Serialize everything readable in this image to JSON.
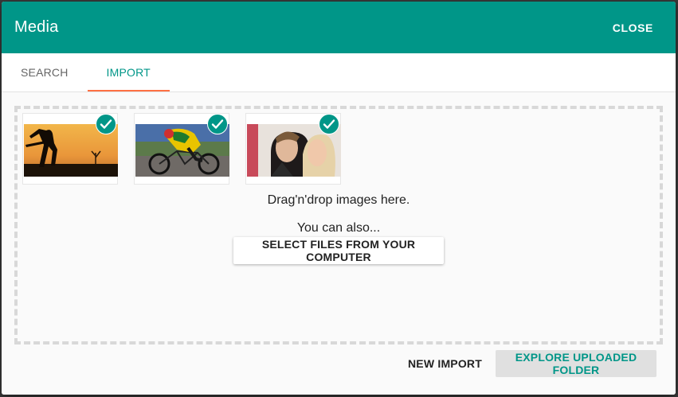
{
  "dialog": {
    "title": "Media",
    "close_label": "CLOSE"
  },
  "tabs": [
    {
      "label": "SEARCH",
      "active": false
    },
    {
      "label": "IMPORT",
      "active": true
    }
  ],
  "dropzone": {
    "thumbnails": [
      {
        "icon": "check-icon",
        "subject": "cricket-silhouette-sunset",
        "selected": true
      },
      {
        "icon": "check-icon",
        "subject": "cyclist-racing",
        "selected": true
      },
      {
        "icon": "check-icon",
        "subject": "couple-portrait",
        "selected": true
      }
    ],
    "drop_text": "Drag'n'drop images here.",
    "also_text": "You can also...",
    "select_button": "SELECT FILES FROM YOUR COMPUTER"
  },
  "footer": {
    "new_import": "NEW IMPORT",
    "explore": "EXPLORE UPLOADED FOLDER"
  },
  "colors": {
    "primary": "#009688",
    "tab_indicator": "#ff7043"
  }
}
